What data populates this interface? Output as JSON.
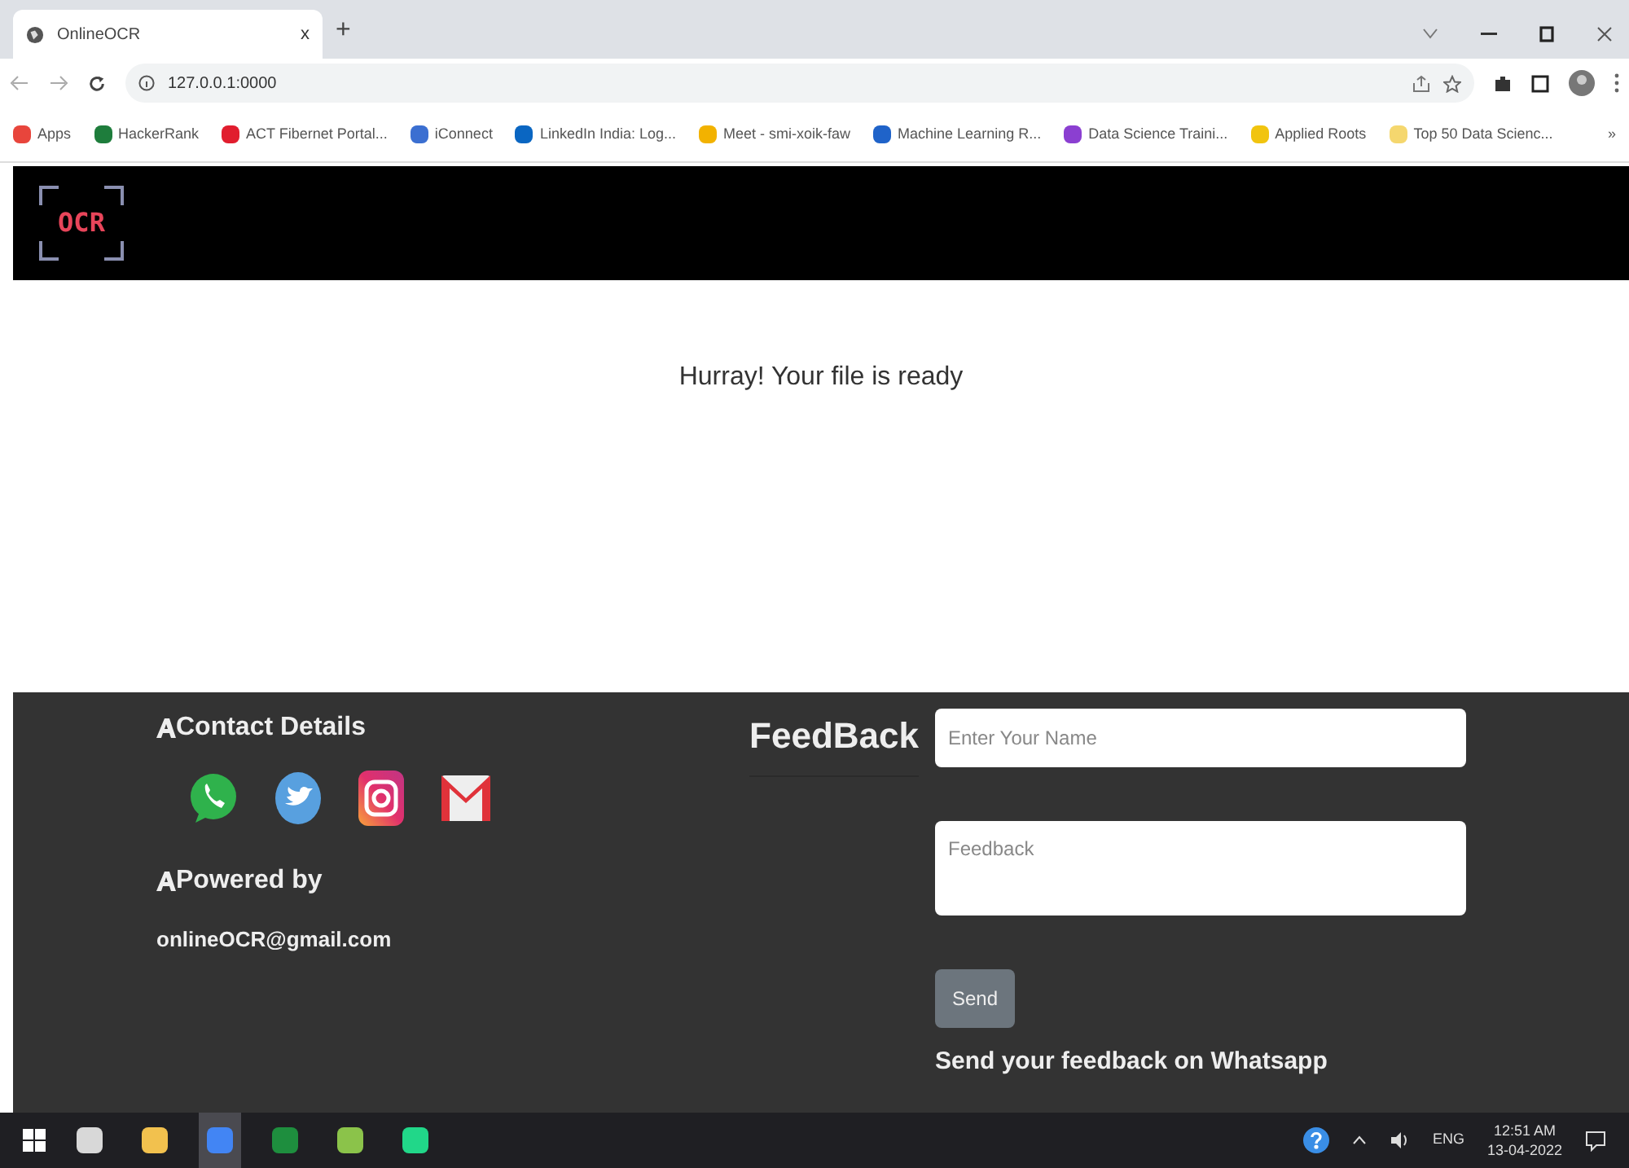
{
  "browser": {
    "tab_title": "OnlineOCR",
    "tab_close": "x",
    "new_tab": "+",
    "url": "127.0.0.1:0000",
    "bookmarks": [
      {
        "label": "Apps",
        "color": "#e8453c"
      },
      {
        "label": "HackerRank",
        "color": "#1e7d3c"
      },
      {
        "label": "ACT Fibernet Portal...",
        "color": "#e11d2e"
      },
      {
        "label": "iConnect",
        "color": "#3b6fd1"
      },
      {
        "label": "LinkedIn India: Log...",
        "color": "#0a66c2"
      },
      {
        "label": "Meet - smi-xoik-faw",
        "color": "#f2b200"
      },
      {
        "label": "Machine Learning R...",
        "color": "#1f63c9"
      },
      {
        "label": "Data Science Traini...",
        "color": "#8b3fd1"
      },
      {
        "label": "Applied Roots",
        "color": "#f1c40f"
      },
      {
        "label": "Top 50 Data Scienc...",
        "color": "#f5d76e"
      }
    ],
    "more": "»"
  },
  "header": {
    "logo": "OCR"
  },
  "message": "Hurray! Your file is ready",
  "footer": {
    "contact_heading": "Contact Details",
    "powered_heading": "Powered by",
    "email": "onlineOCR@gmail.com",
    "feedback_heading": "FeedBack",
    "name_placeholder": "Enter Your Name",
    "feedback_placeholder": "Feedback",
    "send": "Send",
    "whatsapp": "Send your feedback on Whatsapp"
  },
  "taskbar": {
    "apps": [
      {
        "selected": false
      },
      {
        "selected": false
      },
      {
        "selected": true
      },
      {
        "selected": false
      },
      {
        "selected": false
      },
      {
        "selected": false
      }
    ],
    "lang": "ENG",
    "time": "12:51 AM",
    "date": "13-04-2022"
  }
}
